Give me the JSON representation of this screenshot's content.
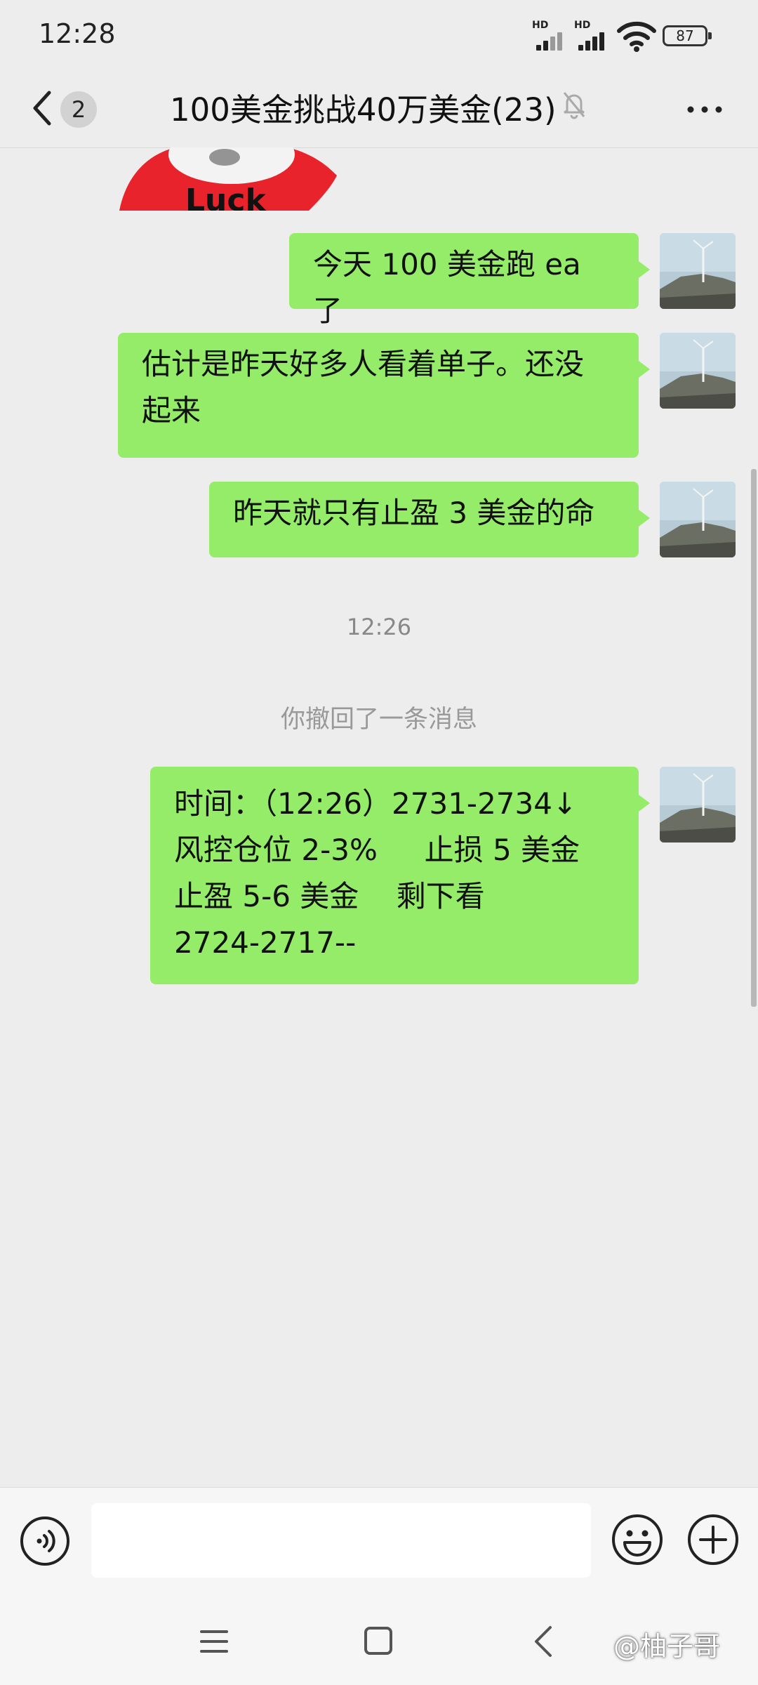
{
  "status_bar": {
    "time": "12:28",
    "hd1": "HD",
    "hd2": "HD",
    "battery": "87"
  },
  "header": {
    "unread_count": "2",
    "title": "100美金挑战40万美金(23)"
  },
  "messages": [
    {
      "type": "sent",
      "text": "今天 100 美金跑 ea 了"
    },
    {
      "type": "sent",
      "line1": "估计是昨天好多人看着单子。还没",
      "line2": "起来"
    },
    {
      "type": "sent",
      "text": "昨天就只有止盈 3 美金的命"
    },
    {
      "type": "time",
      "text": "12:26"
    },
    {
      "type": "system",
      "text": "你撤回了一条消息"
    },
    {
      "type": "sent",
      "line1": "时间：（12:26）2731-2734↓",
      "line2": "风控仓位 2-3%     止损 5 美金",
      "line3": "止盈 5-6 美金    剩下看",
      "line4": "2724-2717--"
    }
  ],
  "sticker": {
    "text": "Luck"
  },
  "watermark": "@柚子哥",
  "colors": {
    "bubble_sent": "#95ec69",
    "background": "#ededed"
  }
}
